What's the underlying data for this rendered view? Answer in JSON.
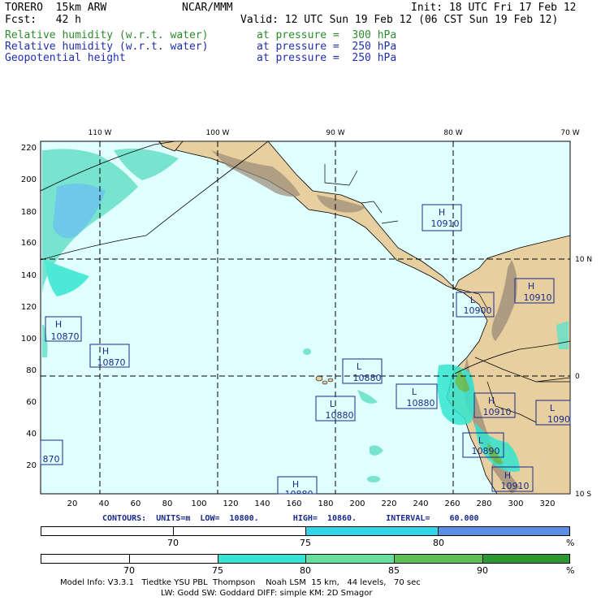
{
  "header": {
    "model": "TORERO  15km ARW",
    "org": "NCAR/MMM",
    "init": "Init: 18 UTC Fri 17 Feb 12",
    "fcst": "Fcst:   42 h",
    "valid": "Valid: 12 UTC Sun 19 Feb 12 (06 CST Sun 19 Feb 12)",
    "fields": [
      {
        "name": "Relative humidity (w.r.t. water)",
        "level": "at pressure =  300 hPa",
        "color": "#2e8b2e"
      },
      {
        "name": "Relative humidity (w.r.t. water)",
        "level": "at pressure =  250 hPa",
        "color": "#1f2fb0"
      },
      {
        "name": "Geopotential height",
        "level": "at pressure =  250 hPa",
        "color": "#1f2fb0"
      }
    ]
  },
  "map": {
    "lon_labels": [
      "110 W",
      "100 W",
      "90 W",
      "80 W",
      "70 W"
    ],
    "lat_labels": [
      "10 N",
      "0",
      "10 S"
    ],
    "y_ticks": [
      "220",
      "200",
      "180",
      "160",
      "140",
      "120",
      "100",
      "80",
      "60",
      "40",
      "20"
    ],
    "x_ticks": [
      "20",
      "40",
      "60",
      "80",
      "100",
      "120",
      "140",
      "160",
      "180",
      "200",
      "220",
      "240",
      "260",
      "280",
      "300",
      "320"
    ],
    "centers": [
      {
        "type": "H",
        "value": "10910"
      },
      {
        "type": "L",
        "value": "10900"
      },
      {
        "type": "H",
        "value": "10910"
      },
      {
        "type": "H",
        "value": "10870"
      },
      {
        "type": "H",
        "value": "10870"
      },
      {
        "type": "L",
        "value": "10880"
      },
      {
        "type": "L",
        "value": "10880"
      },
      {
        "type": "L",
        "value": "10880"
      },
      {
        "type": "H",
        "value": "10910"
      },
      {
        "type": "L",
        "value": "1090"
      },
      {
        "type": "L",
        "value": "10890"
      },
      {
        "type": "H",
        "value": "10910"
      },
      {
        "type": "",
        "value": "870"
      },
      {
        "type": "H",
        "value": "10880"
      }
    ],
    "colors": {
      "ocean": "#e0ffff",
      "land": "#e8cfa0",
      "mountain": "#9a8a78"
    }
  },
  "contours": "CONTOURS:  UNITS=m  LOW=  10800.       HIGH=  10860.      INTERVAL=    60.000",
  "colorbar1": {
    "labels": [
      "70",
      "75",
      "80",
      "%"
    ],
    "colors": [
      "#ffffff",
      "#ffffff",
      "#33d6e6",
      "#5b8fe6"
    ]
  },
  "colorbar2": {
    "labels": [
      "70",
      "75",
      "80",
      "85",
      "90",
      "%"
    ],
    "colors": [
      "#ffffff",
      "#ffffff",
      "#33e6d0",
      "#66e0a0",
      "#5cbf50",
      "#2e9930"
    ]
  },
  "footer": {
    "line1": "Model Info: V3.3.1   Tiedtke YSU PBL  Thompson    Noah LSM  15 km,   44 levels,   70 sec",
    "line2": "LW: Godd SW: Goddard DIFF: simple KM: 2D Smagor"
  }
}
